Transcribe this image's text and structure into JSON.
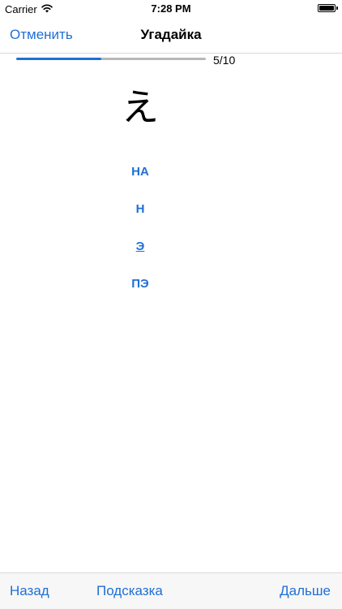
{
  "status": {
    "carrier": "Carrier",
    "time": "7:28 PM"
  },
  "nav": {
    "cancel_label": "Отменить",
    "title": "Угадайка"
  },
  "progress": {
    "text": "5/10",
    "fraction": 0.45
  },
  "question": {
    "kana": "え"
  },
  "choices": [
    {
      "label": "НА"
    },
    {
      "label": "Н"
    },
    {
      "label": "Э"
    },
    {
      "label": "ПЭ"
    }
  ],
  "toolbar": {
    "back_label": "Назад",
    "hint_label": "Подсказка",
    "next_label": "Дальше"
  },
  "colors": {
    "accent": "#1f6fd6"
  }
}
